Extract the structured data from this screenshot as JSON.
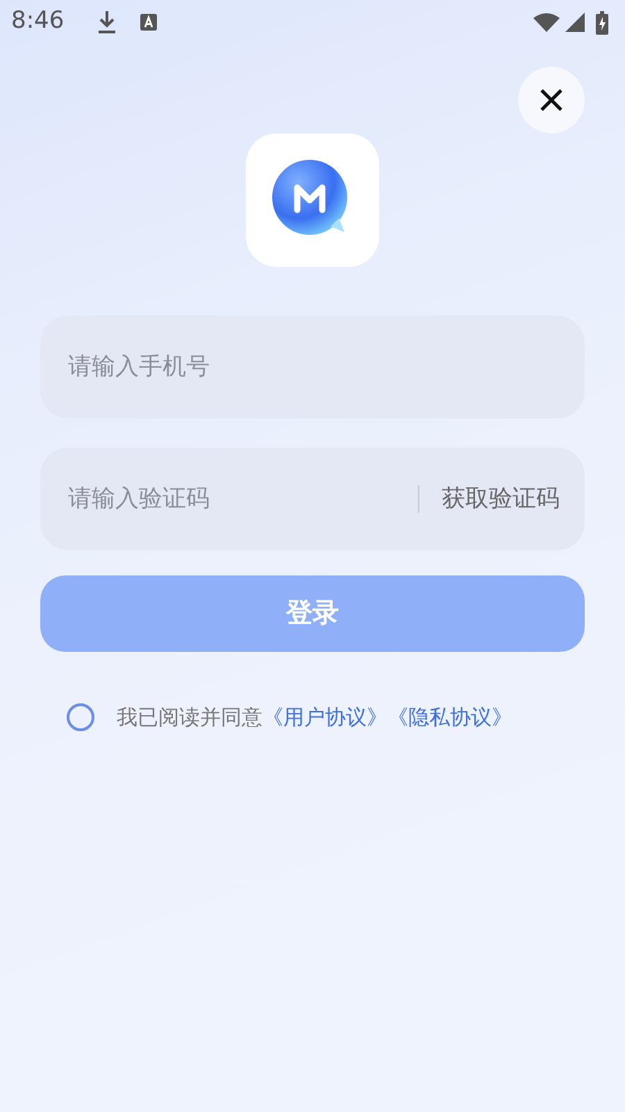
{
  "status_bar": {
    "time": "8:46"
  },
  "phone_field": {
    "placeholder": "请输入手机号"
  },
  "code_field": {
    "placeholder": "请输入验证码",
    "action": "获取验证码"
  },
  "login_button": {
    "label": "登录",
    "disabled": true
  },
  "agreement": {
    "checked": false,
    "text": "我已阅读并同意",
    "links": [
      "《用户协议》",
      "《隐私协议》"
    ]
  }
}
